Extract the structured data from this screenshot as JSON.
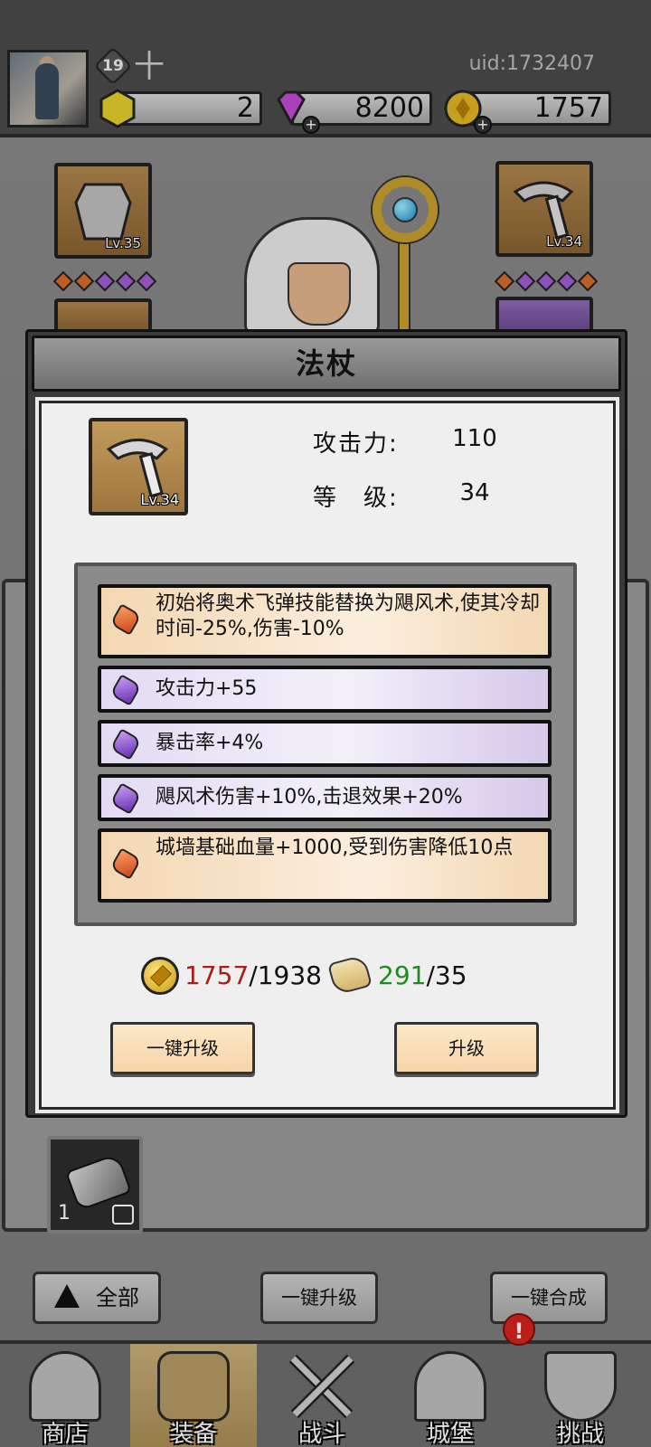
{
  "header": {
    "player_level": "19",
    "uid": "uid:1732407",
    "resources": [
      {
        "name": "yellow-gem",
        "value": "2"
      },
      {
        "name": "diamond",
        "value": "8200"
      },
      {
        "name": "gold-coin",
        "value": "1757"
      }
    ]
  },
  "equipment_slots": {
    "left_top_level": "Lv.35",
    "right_top_level": "Lv.34"
  },
  "modal": {
    "title": "法杖",
    "item_level_badge": "Lv.34",
    "stats": [
      {
        "label": "攻击力:",
        "value": "110"
      },
      {
        "label": "等　级:",
        "value": "34"
      }
    ],
    "affixes": [
      {
        "rarity": "orange",
        "text": "初始将奥术飞弹技能替换为飓风术,使其冷却时间-25%,伤害-10%"
      },
      {
        "rarity": "purple",
        "text": "攻击力+55"
      },
      {
        "rarity": "purple",
        "text": "暴击率+4%"
      },
      {
        "rarity": "purple",
        "text": "飓风术伤害+10%,击退效果+20%"
      },
      {
        "rarity": "orange",
        "text": "城墙基础血量+1000,受到伤害降低10点"
      }
    ],
    "cost": {
      "gold_have": "1757",
      "gold_need": "/1938",
      "scroll_have": "291",
      "scroll_need": "/35"
    },
    "buttons": {
      "one_click_upgrade": "一键升级",
      "upgrade": "升级"
    }
  },
  "inventory": {
    "stone_count": "1"
  },
  "bottom_actions": {
    "filter_all": "全部",
    "one_click_upgrade": "一键升级",
    "one_click_merge": "一键合成"
  },
  "nav": {
    "items": [
      {
        "label": "商店"
      },
      {
        "label": "装备"
      },
      {
        "label": "战斗"
      },
      {
        "label": "城堡"
      },
      {
        "label": "挑战"
      }
    ],
    "active_index": 1,
    "notify_badge": "!"
  },
  "colors": {
    "orange_rarity": "#d96a2b",
    "purple_rarity": "#a35ed6",
    "insufficient": "#a5201a",
    "sufficient": "#1f8a22"
  }
}
